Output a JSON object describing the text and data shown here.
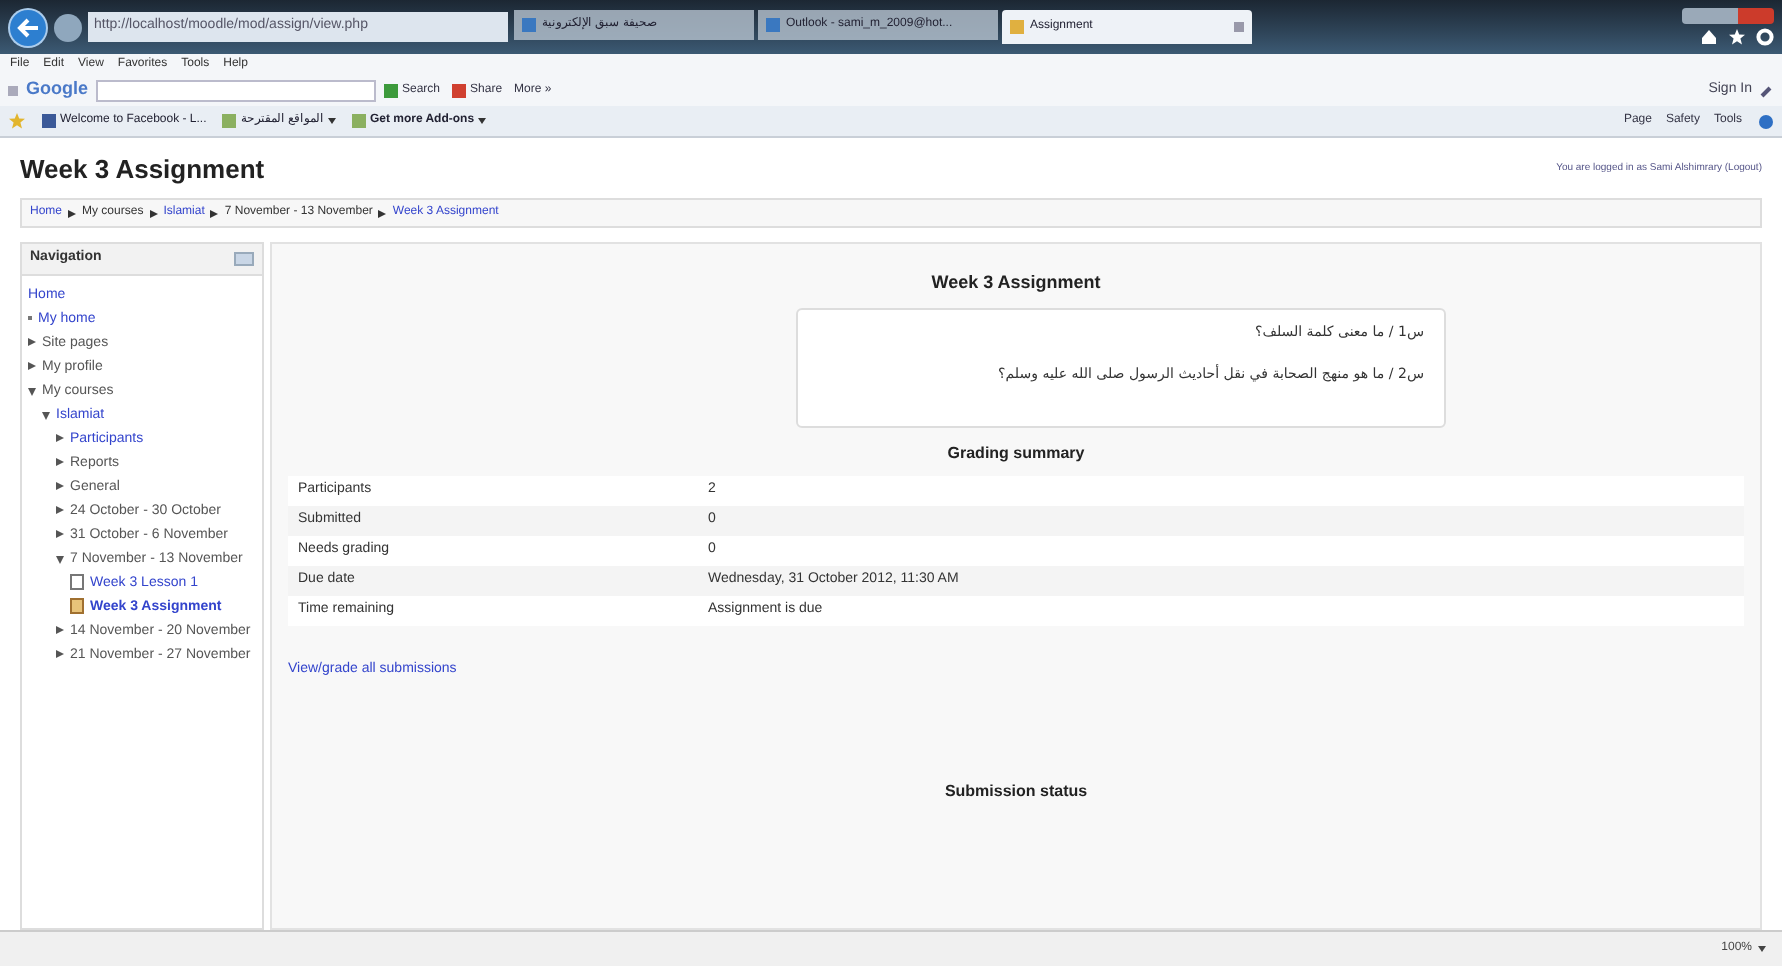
{
  "browser": {
    "address": "http://localhost/moodle/mod/assign/view.php",
    "tabs": [
      {
        "label": "صحيفة سبق الإلكترونية",
        "selected": false
      },
      {
        "label": "Outlook - sami_m_2009@hot...",
        "selected": false
      },
      {
        "label": "Assignment",
        "selected": true
      }
    ],
    "menu": [
      "File",
      "Edit",
      "View",
      "Favorites",
      "Tools",
      "Help"
    ],
    "google_toolbar": {
      "logo": "Google",
      "buttons": [
        "Search",
        "Share",
        "More »"
      ],
      "sign_in": "Sign In"
    },
    "favorites": [
      "Welcome to Facebook - L...",
      "المواقع المقترحة",
      "Get more Add-ons"
    ],
    "commands": [
      "Page",
      "Safety",
      "Tools"
    ],
    "zoom": "100%"
  },
  "page": {
    "title": "Week 3 Assignment",
    "login_note": "You are logged in as Sami Alshimrary (Logout)",
    "breadcrumb": [
      {
        "label": "Home",
        "link": true
      },
      {
        "label": "My courses",
        "link": false
      },
      {
        "label": "Islamiat",
        "link": true
      },
      {
        "label": "7 November - 13 November",
        "link": false
      },
      {
        "label": "Week 3 Assignment",
        "link": true
      }
    ],
    "navigation": {
      "title": "Navigation",
      "items": [
        {
          "label": "Home",
          "kind": "plain",
          "link": true
        },
        {
          "label": "My home",
          "kind": "bullet",
          "link": true
        },
        {
          "label": "Site pages",
          "kind": "branch",
          "expanded": false,
          "link": false
        },
        {
          "label": "My profile",
          "kind": "branch",
          "expanded": false,
          "link": false
        },
        {
          "label": "My courses",
          "kind": "branch",
          "expanded": true,
          "link": false,
          "children": [
            {
              "label": "Islamiat",
              "kind": "branch",
              "expanded": true,
              "link": true,
              "children": [
                {
                  "label": "Participants",
                  "kind": "branch",
                  "expanded": false,
                  "link": true
                },
                {
                  "label": "Reports",
                  "kind": "branch",
                  "expanded": false,
                  "link": false
                },
                {
                  "label": "General",
                  "kind": "branch",
                  "expanded": false,
                  "link": false
                },
                {
                  "label": "24 October - 30 October",
                  "kind": "branch",
                  "expanded": false,
                  "link": false
                },
                {
                  "label": "31 October - 6 November",
                  "kind": "branch",
                  "expanded": false,
                  "link": false
                },
                {
                  "label": "7 November - 13 November",
                  "kind": "branch",
                  "expanded": true,
                  "link": false,
                  "children": [
                    {
                      "label": "Week 3 Lesson 1",
                      "kind": "page",
                      "link": true,
                      "selected": false
                    },
                    {
                      "label": "Week 3 Assignment",
                      "kind": "assignment",
                      "link": true,
                      "selected": true
                    }
                  ]
                },
                {
                  "label": "14 November - 20 November",
                  "kind": "branch",
                  "expanded": false,
                  "link": false
                },
                {
                  "label": "21 November - 27 November",
                  "kind": "branch",
                  "expanded": false,
                  "link": false
                }
              ]
            }
          ]
        }
      ]
    },
    "main": {
      "heading": "Week 3 Assignment",
      "intro": [
        "س1 / ما معنى كلمة السلف؟",
        "س2 / ما هو منهج الصحابة في نقل أحاديث الرسول صلى الله عليه وسلم؟"
      ],
      "grading_heading": "Grading summary",
      "grading_rows": [
        {
          "label": "Participants",
          "value": "2"
        },
        {
          "label": "Submitted",
          "value": "0"
        },
        {
          "label": "Needs grading",
          "value": "0"
        },
        {
          "label": "Due date",
          "value": "Wednesday, 31 October 2012, 11:30 AM"
        },
        {
          "label": "Time remaining",
          "value": "Assignment is due"
        }
      ],
      "link": "View/grade all submissions",
      "submission_heading": "Submission status"
    }
  }
}
